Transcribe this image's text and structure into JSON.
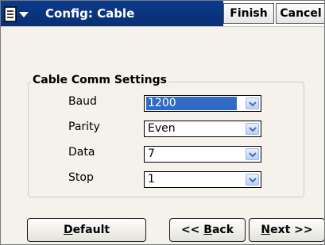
{
  "titlebar": {
    "title": "Config: Cable",
    "finish_label": "Finish",
    "cancel_label": "Cancel"
  },
  "group": {
    "legend": "Cable Comm Settings",
    "fields": [
      {
        "label": "Baud",
        "value": "1200",
        "selected": true
      },
      {
        "label": "Parity",
        "value": "Even",
        "selected": false
      },
      {
        "label": "Data",
        "value": "7",
        "selected": false
      },
      {
        "label": "Stop",
        "value": "1",
        "selected": false
      }
    ]
  },
  "buttons": {
    "default_first": "D",
    "default_rest": "efault",
    "back_prefix": "<< ",
    "back_first": "B",
    "back_rest": "ack",
    "next_first": "N",
    "next_rest": "ext >>"
  },
  "colors": {
    "title_bar": "#0b3a8a",
    "selection": "#316ac5",
    "dialog_bg": "#f4f2ea"
  },
  "icons": {
    "app_menu": "app-menu-icon",
    "dropdown": "chevron-down-icon"
  }
}
